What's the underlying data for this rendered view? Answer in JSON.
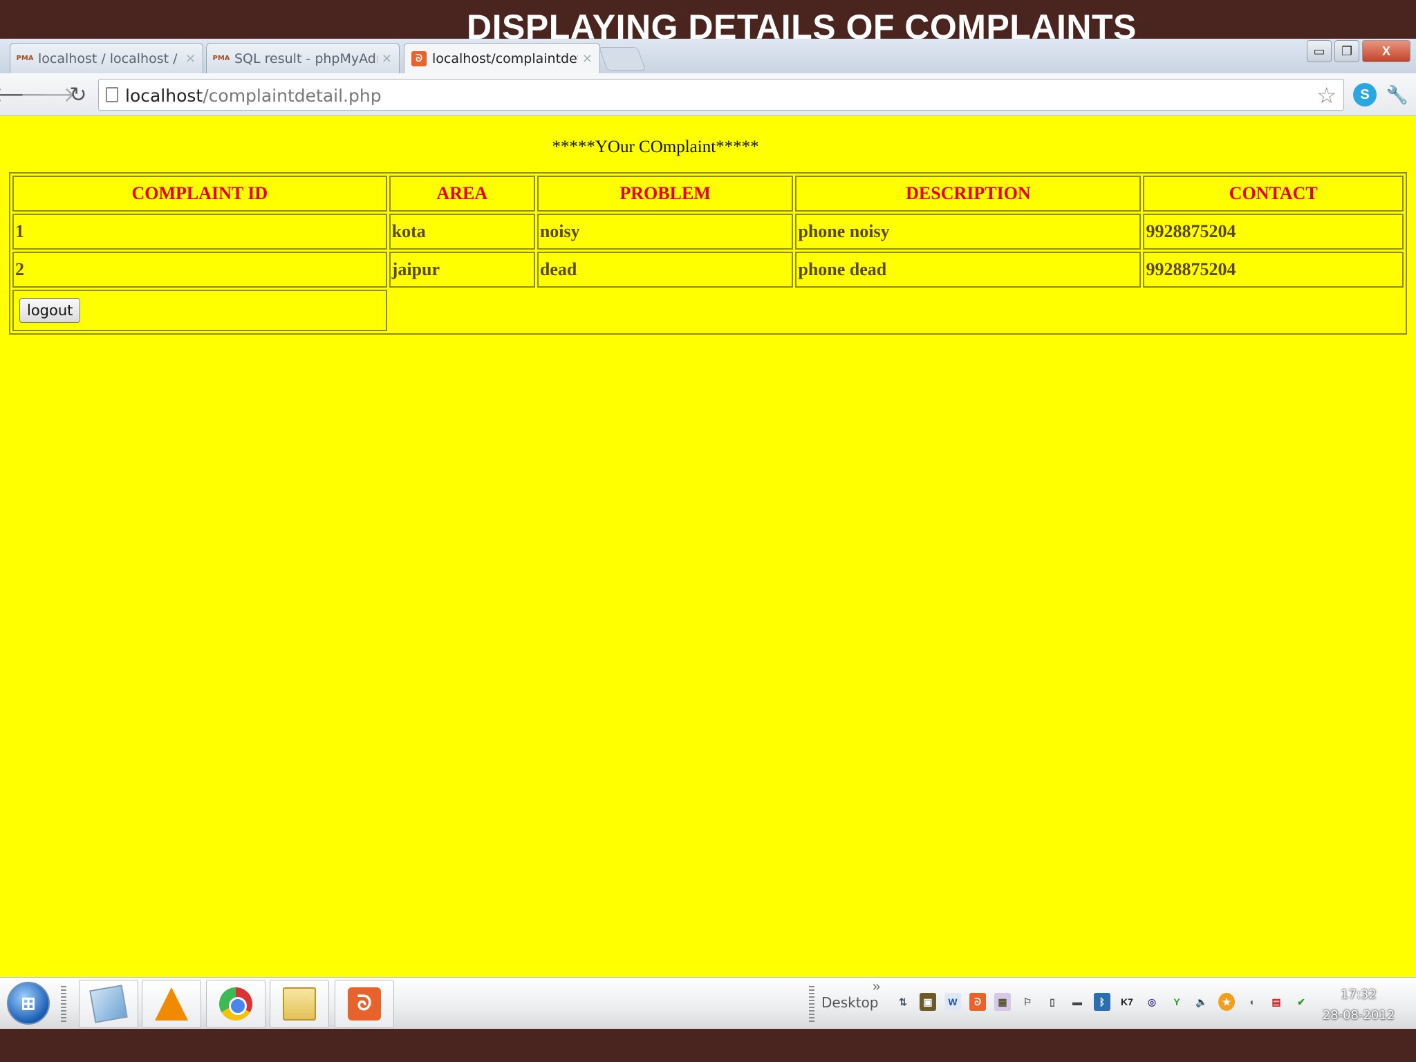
{
  "slide": {
    "title": "DISPLAYING DETAILS OF COMPLAINTS"
  },
  "browser": {
    "tabs": [
      {
        "label": "localhost / localhost / com",
        "favicon": "PMA"
      },
      {
        "label": "SQL result - phpMyAdmin",
        "favicon": "PMA"
      },
      {
        "label": "localhost/complaintdetail.",
        "favicon": "xampp-icon"
      }
    ],
    "url_host": "localhost",
    "url_path": "/complaintdetail.php",
    "window_controls": {
      "minimize": "▭",
      "restore": "❐",
      "close": "X"
    }
  },
  "page": {
    "heading": "*****YOur COmplaint*****",
    "table": {
      "headers": [
        "COMPLAINT ID",
        "AREA",
        "PROBLEM",
        "DESCRIPTION",
        "CONTACT"
      ],
      "rows": [
        [
          "1",
          "kota",
          "noisy",
          "phone noisy",
          "9928875204"
        ],
        [
          "2",
          "jaipur",
          "dead",
          "phone dead",
          "9928875204"
        ]
      ]
    },
    "logout_label": "logout",
    "colors": {
      "page_bg": "#ffff00",
      "header_text": "#e8001b",
      "cell_text": "#5a4a10"
    }
  },
  "taskbar": {
    "desktop_label": "Desktop",
    "chevron": "»",
    "clock_time": "17:32",
    "clock_date": "28-08-2012"
  }
}
